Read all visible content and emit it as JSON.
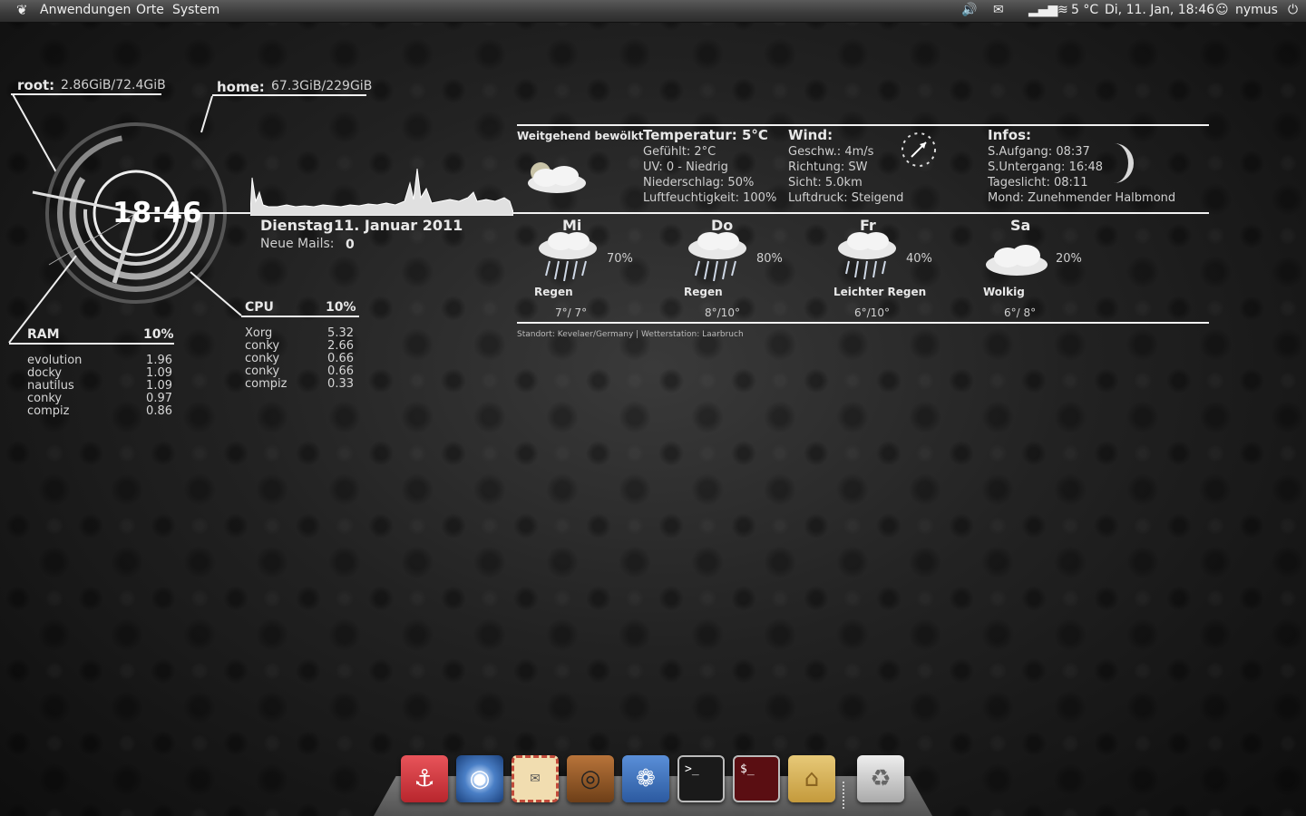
{
  "panel": {
    "menus": [
      "Anwendungen",
      "Orte",
      "System"
    ],
    "weather": "5 °C",
    "datetime": "Di, 11. Jan, 18:46",
    "user": "nymus"
  },
  "disks": {
    "root_label": "root:",
    "root_value": "2.86GiB/72.4GiB",
    "home_label": "home:",
    "home_value": "67.3GiB/229GiB"
  },
  "clock": {
    "time": "18:46"
  },
  "date_line": {
    "day": "Dienstag",
    "date": "11. Januar 2011",
    "mails_label": "Neue Mails:",
    "mails_value": "0"
  },
  "ram": {
    "label": "RAM",
    "percent": "10%",
    "processes": [
      {
        "name": "evolution",
        "value": "1.96"
      },
      {
        "name": "docky",
        "value": "1.09"
      },
      {
        "name": "nautilus",
        "value": "1.09"
      },
      {
        "name": "conky",
        "value": "0.97"
      },
      {
        "name": "compiz",
        "value": "0.86"
      }
    ]
  },
  "cpu": {
    "label": "CPU",
    "percent": "10%",
    "processes": [
      {
        "name": "Xorg",
        "value": "5.32"
      },
      {
        "name": "conky",
        "value": "2.66"
      },
      {
        "name": "conky",
        "value": "0.66"
      },
      {
        "name": "conky",
        "value": "0.66"
      },
      {
        "name": "compiz",
        "value": "0.33"
      }
    ]
  },
  "weather": {
    "current_condition": "Weitgehend bewölkt",
    "temp_title": "Temperatur:  5°C",
    "temp_lines": [
      "Gefühlt: 2°C",
      "UV: 0 - Niedrig",
      "Niederschlag: 50%",
      "Luftfeuchtigkeit: 100%"
    ],
    "wind_title": "Wind:",
    "wind_lines": [
      "Geschw.: 4m/s",
      "Richtung: SW",
      "Sicht:  5.0km",
      "Luftdruck: Steigend"
    ],
    "info_title": "Infos:",
    "info_lines": [
      "S.Aufgang: 08:37",
      "S.Untergang: 16:48",
      "Tageslicht: 08:11",
      "Mond: Zunehmender Halbmond"
    ],
    "forecast": [
      {
        "day": "Mi",
        "pct": "70%",
        "cond": "Regen",
        "temps": "7°/ 7°"
      },
      {
        "day": "Do",
        "pct": "80%",
        "cond": "Regen",
        "temps": "8°/10°"
      },
      {
        "day": "Fr",
        "pct": "40%",
        "cond": "Leichter Regen",
        "temps": "6°/10°"
      },
      {
        "day": "Sa",
        "pct": "20%",
        "cond": "Wolkig",
        "temps": "6°/ 8°"
      }
    ],
    "footer": "Standort:  Kevelaer/Germany | Wetterstation:  Laarbruch"
  },
  "dock": {
    "items": [
      "anchor-icon",
      "chrome-browser-icon",
      "mail-letter-icon",
      "speaker-icon",
      "footprint-icon",
      "terminal-icon",
      "root-terminal-icon",
      "home-folder-icon",
      "trash-icon"
    ]
  },
  "colors": {
    "text": "#e8e8e8",
    "panel": "#3b3b3b"
  }
}
